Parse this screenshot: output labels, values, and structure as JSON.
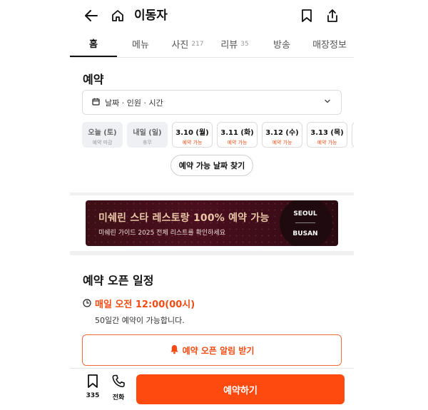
{
  "header": {
    "title": "이동자",
    "icons": [
      "back-arrow-icon",
      "home-icon",
      "bookmark-icon",
      "share-icon"
    ]
  },
  "tabs": [
    {
      "label": "홈",
      "count": "",
      "active": true
    },
    {
      "label": "메뉴",
      "count": ""
    },
    {
      "label": "사진",
      "count": "217"
    },
    {
      "label": "리뷰",
      "count": "35"
    },
    {
      "label": "방송",
      "count": ""
    },
    {
      "label": "매장정보",
      "count": ""
    }
  ],
  "reserve": {
    "title": "예약",
    "picker_text": "날짜 · 인원 · 시간",
    "dates": [
      {
        "day": "오늘 (토)",
        "status": "예약 마감",
        "available": false
      },
      {
        "day": "내일 (일)",
        "status": "휴무",
        "available": false
      },
      {
        "day": "3.10 (월)",
        "status": "예약 가능",
        "available": true
      },
      {
        "day": "3.11 (화)",
        "status": "예약 가능",
        "available": true
      },
      {
        "day": "3.12 (수)",
        "status": "예약 가능",
        "available": true
      },
      {
        "day": "3.13 (목)",
        "status": "예약 가능",
        "available": true
      }
    ],
    "find_button": "예약 가능 날짜 찾기"
  },
  "banner": {
    "headline": "미쉐린 스타 레스토랑 100% 예약 가능",
    "sub": "미쉐린 가이드 2025 전체 리스트를 확인하세요",
    "city1": "SEOUL",
    "city2": "BUSAN"
  },
  "open_schedule": {
    "title": "예약 오픈 일정",
    "time": "매일 오전 12:00(00시)",
    "desc": "50일간 예약이 가능합니다.",
    "alarm_button": "예약 오픈 알림 받기"
  },
  "bottom": {
    "bookmark_count": "335",
    "call_label": "전화",
    "cta": "예약하기"
  },
  "colors": {
    "accent": "#ff4a0f",
    "accent_text": "#f04b12"
  }
}
